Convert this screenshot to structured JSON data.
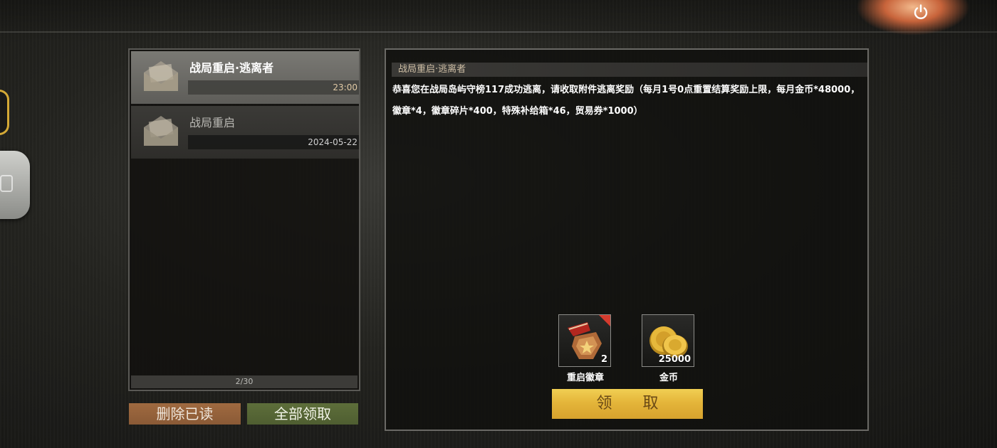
{
  "header": {
    "power_icon": "power-icon"
  },
  "mail_list": {
    "items": [
      {
        "title": "战局重启·逃离者",
        "time": "23:00",
        "icon": "envelope-open-icon",
        "selected": true
      },
      {
        "title": "战局重启",
        "time": "2024-05-22",
        "icon": "envelope-open-icon",
        "selected": false
      }
    ],
    "page_indicator": "2/30",
    "delete_read_label": "删除已读",
    "claim_all_label": "全部领取"
  },
  "detail": {
    "title": "战局重启·逃离者",
    "body": "恭喜您在战局岛屿守榜117成功逃离，请收取附件逃离奖励（每月1号0点重置结算奖励上限，每月金币*48000，徽章*4，徽章碎片*400，特殊补给箱*46，贸易券*1000）",
    "rewards": [
      {
        "name": "重启徽章",
        "count": "2",
        "icon": "medal-icon"
      },
      {
        "name": "金币",
        "count": "25000",
        "icon": "gold-coins-icon"
      }
    ],
    "receive_label": "领 取"
  },
  "colors": {
    "accent_gold": "#e4b53a",
    "delete_btn": "#9a643c",
    "claim_all_btn": "#566736",
    "reward_flag": "#d43b2e"
  }
}
